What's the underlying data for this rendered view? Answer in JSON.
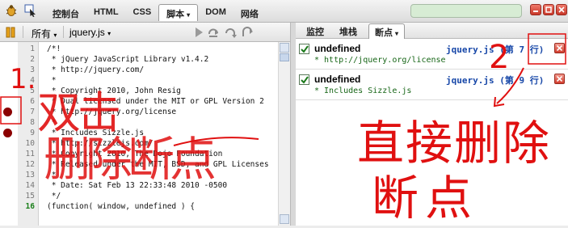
{
  "toolbar": {
    "tabs": [
      {
        "label": "控制台",
        "active": false
      },
      {
        "label": "HTML",
        "active": false
      },
      {
        "label": "CSS",
        "active": false
      },
      {
        "label": "脚本",
        "active": true
      },
      {
        "label": "DOM",
        "active": false
      },
      {
        "label": "网络",
        "active": false
      }
    ],
    "active_caret": "▾",
    "icons": [
      "firebug-icon",
      "inspect-icon",
      "minimize-icon",
      "restore-icon",
      "close-icon"
    ]
  },
  "script_toolbar": {
    "filter_label": "所有",
    "filter_caret": "▾",
    "file_label": "jquery.js",
    "file_caret": "▾",
    "icons": [
      "pause-icon",
      "continue-icon",
      "step-over-icon",
      "step-into-icon",
      "step-out-icon"
    ]
  },
  "code": {
    "lines": [
      {
        "num": "1",
        "text": "/*!",
        "current": false
      },
      {
        "num": "2",
        "text": " * jQuery JavaScript Library v1.4.2",
        "current": false
      },
      {
        "num": "3",
        "text": " * http://jquery.com/",
        "current": false
      },
      {
        "num": "4",
        "text": " *",
        "current": false
      },
      {
        "num": "5",
        "text": " * Copyright 2010, John Resig",
        "current": false
      },
      {
        "num": "6",
        "text": " * Dual licensed under the MIT or GPL Version 2",
        "current": false
      },
      {
        "num": "7",
        "text": " * http://jquery.org/license",
        "current": false
      },
      {
        "num": "8",
        "text": " *",
        "current": false
      },
      {
        "num": "9",
        "text": " * Includes Sizzle.js",
        "current": false
      },
      {
        "num": "10",
        "text": " * http://sizzlejs.com/",
        "current": false
      },
      {
        "num": "11",
        "text": " * Copyright 2010, The Dojo Foundation",
        "current": false
      },
      {
        "num": "12",
        "text": " * Released under the MIT, BSD, and GPL Licenses",
        "current": false
      },
      {
        "num": "13",
        "text": " *",
        "current": false
      },
      {
        "num": "14",
        "text": " * Date: Sat Feb 13 22:33:48 2010 -0500",
        "current": false
      },
      {
        "num": "15",
        "text": " */",
        "current": false
      },
      {
        "num": "16",
        "text": "(function( window, undefined ) {",
        "current": true
      }
    ],
    "breakpoint_lines": [
      7,
      9
    ]
  },
  "side_panel": {
    "tabs": [
      {
        "label": "监控",
        "active": false
      },
      {
        "label": "堆栈",
        "active": false
      },
      {
        "label": "断点",
        "active": true
      }
    ],
    "active_caret": "▾",
    "breakpoints": [
      {
        "name": "undefined",
        "location": "jquery.js (第 7 行)",
        "code": "* http://jquery.org/license",
        "checked": true
      },
      {
        "name": "undefined",
        "location": "jquery.js (第 9 行)",
        "code": "* Includes Sizzle.js",
        "checked": true
      }
    ]
  },
  "annotations": {
    "mark_1": "1.",
    "mark_2": "2",
    "left_line1": "双击",
    "left_line2": "删除断点",
    "right_line1": "直接删除",
    "right_line2": "断点",
    "color": "#e01010"
  },
  "colors": {
    "search_box": "#d7ecd4",
    "breakpoint": "#8b0000",
    "current_line_number": "#1a7f1a",
    "location_text": "#1747a8",
    "code_text": "#176617"
  }
}
